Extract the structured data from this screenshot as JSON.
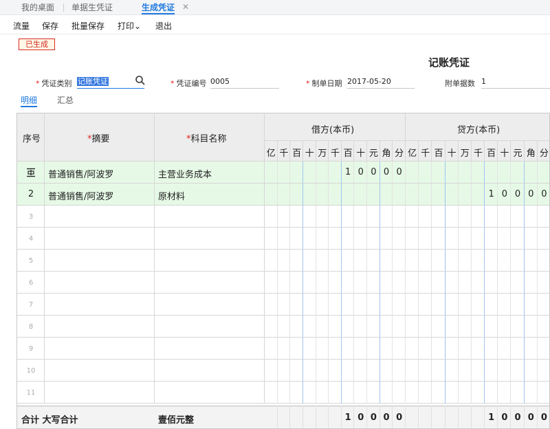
{
  "tabs": [
    {
      "label": "我的桌面"
    },
    {
      "label": "单据生凭证"
    },
    {
      "label": "生成凭证"
    }
  ],
  "tab_close": "✕",
  "toolbar": {
    "items": [
      "流量",
      "保存",
      "批量保存",
      "打印",
      "退出"
    ],
    "print_caret": "⌄"
  },
  "status_badge": "已生成",
  "voucher_title": "记账凭证",
  "fields": {
    "type": {
      "label": "凭证类别",
      "value": "记账凭证"
    },
    "number": {
      "label": "凭证编号",
      "value": "0005"
    },
    "date": {
      "label": "制单日期",
      "value": "2017-05-20"
    },
    "attach": {
      "label": "附单据数",
      "value": "1"
    }
  },
  "subtabs": [
    "明细",
    "汇总"
  ],
  "headers": {
    "seq": "序号",
    "summary": "摘要",
    "account": "科目名称",
    "debit": "借方(本币)",
    "credit": "贷方(本币)",
    "units": [
      "亿",
      "千",
      "百",
      "十",
      "万",
      "千",
      "百",
      "十",
      "元",
      "角",
      "分"
    ]
  },
  "rows": [
    {
      "no": "",
      "icon": "insert-row-icon",
      "summary": "普通销售/阿波罗",
      "account": "主营业务成本",
      "debit": [
        "",
        "",
        "",
        "",
        "",
        "",
        "1",
        "0",
        "0",
        "0",
        "0"
      ],
      "credit": [
        "",
        "",
        "",
        "",
        "",
        "",
        "",
        "",
        "",
        "",
        ""
      ]
    },
    {
      "no": "2",
      "summary": "普通销售/阿波罗",
      "account": "原材料",
      "debit": [
        "",
        "",
        "",
        "",
        "",
        "",
        "",
        "",
        "",
        "",
        ""
      ],
      "credit": [
        "",
        "",
        "",
        "",
        "",
        "",
        "1",
        "0",
        "0",
        "0",
        "0"
      ]
    },
    {
      "no": "3"
    },
    {
      "no": "4"
    },
    {
      "no": "5"
    },
    {
      "no": "6"
    },
    {
      "no": "7"
    },
    {
      "no": "8"
    },
    {
      "no": "9"
    },
    {
      "no": "10"
    },
    {
      "no": "11"
    }
  ],
  "footer": {
    "label": "合计 大写合计",
    "amount_words": "壹佰元整",
    "debit": [
      "",
      "",
      "",
      "",
      "",
      "",
      "1",
      "0",
      "0",
      "0",
      "0"
    ],
    "credit": [
      "",
      "",
      "",
      "",
      "",
      "",
      "1",
      "0",
      "0",
      "0",
      "0"
    ]
  },
  "colors": {
    "accent": "#1f7ae0",
    "row_highlight": "#e6f9e6",
    "badge_red": "#d52b1e"
  }
}
